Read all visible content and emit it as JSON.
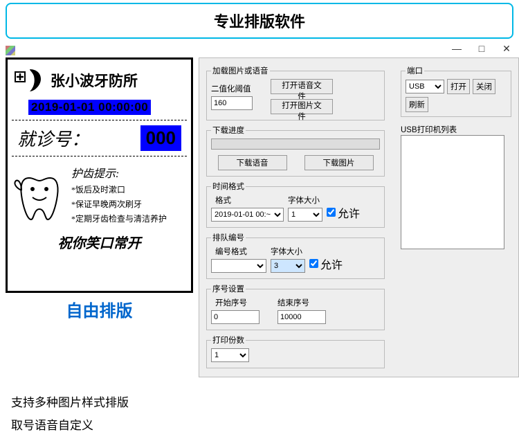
{
  "banner": {
    "title": "专业排版软件"
  },
  "preview": {
    "clinic_name": "张小波牙防所",
    "timestamp": "2019-01-01 00:00:00",
    "ticket_label": "就诊号：",
    "ticket_number": "000",
    "tips_title": "护齿提示:",
    "tip1": "*饭后及时漱口",
    "tip2": "*保证早晚两次刷牙",
    "tip3": "*定期牙齿检查与清洁养护",
    "wish": "祝你笑口常开",
    "free_layout": "自由排版"
  },
  "settings": {
    "load_group": "加载图片或语音",
    "threshold_label": "二值化阈值",
    "threshold_value": "160",
    "open_audio": "打开语音文件",
    "open_image": "打开图片文件",
    "port_group": "端口",
    "port_value": "USB",
    "open_btn": "打开",
    "close_btn": "关闭",
    "refresh_btn": "刷新",
    "printer_list_label": "USB打印机列表",
    "progress_group": "下载进度",
    "download_audio": "下载语音",
    "download_image": "下载图片",
    "time_group": "时间格式",
    "format_label": "格式",
    "time_format_value": "2019-01-01 00:~",
    "font_size_label": "字体大小",
    "time_font_value": "1",
    "allow_label": "允许",
    "queue_group": "排队编号",
    "num_format_label": "编号格式",
    "queue_font_value": "3",
    "seq_group": "序号设置",
    "start_label": "开始序号",
    "start_value": "0",
    "end_label": "结束序号",
    "end_value": "10000",
    "copies_group": "打印份数",
    "copies_value": "1"
  },
  "features": {
    "f1": "支持多种图片样式排版",
    "f2": "取号语音自定义"
  }
}
